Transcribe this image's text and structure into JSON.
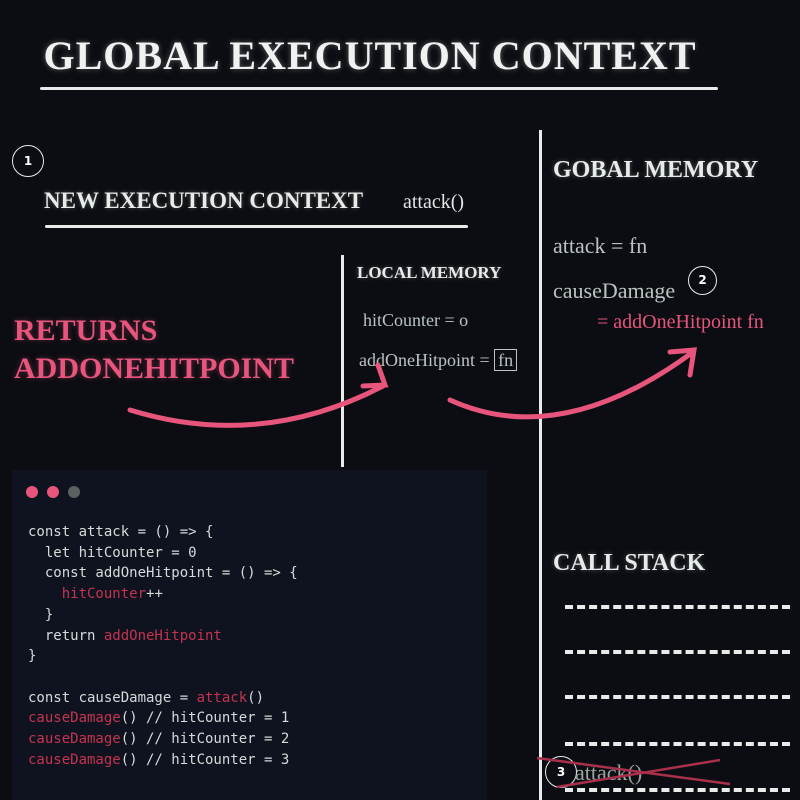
{
  "title": "GLOBAL EXECUTION CONTEXT",
  "step1": {
    "number": "1",
    "heading": "NEW EXECUTION CONTEXT",
    "call": "attack()"
  },
  "local_memory": {
    "heading": "LOCAL MEMORY",
    "hit_counter": "hitCounter = o",
    "add_one_label": "addOneHitpoint =",
    "add_one_value": "fn"
  },
  "returns": {
    "line1": "RETURNS",
    "line2": "ADDONEHITPOINT"
  },
  "global_memory": {
    "heading": "GOBAL MEMORY",
    "attack": "attack = fn",
    "cause_damage": "causeDamage",
    "step2": "2",
    "cause_damage_value": "= addOneHitpoint fn"
  },
  "call_stack": {
    "heading": "CALL STACK",
    "step3": "3",
    "frame": "attack()"
  },
  "code": {
    "lines": [
      [
        [
          "const attack = () => {",
          ""
        ]
      ],
      [
        [
          "  let hitCounter = 0",
          ""
        ]
      ],
      [
        [
          "  const addOneHitpoint = () => {",
          ""
        ]
      ],
      [
        [
          "    ",
          ""
        ],
        [
          "hitCounter",
          "kw"
        ],
        [
          "++",
          ""
        ]
      ],
      [
        [
          "  }",
          ""
        ]
      ],
      [
        [
          "  return ",
          ""
        ],
        [
          "addOneHitpoint",
          "kw"
        ]
      ],
      [
        [
          "}",
          ""
        ]
      ],
      [
        [
          "",
          ""
        ]
      ],
      [
        [
          "const causeDamage = ",
          ""
        ],
        [
          "attack",
          "kw"
        ],
        [
          "()",
          ""
        ]
      ],
      [
        [
          "causeDamage",
          "kw"
        ],
        [
          "() // hitCounter = 1",
          ""
        ]
      ],
      [
        [
          "causeDamage",
          "kw"
        ],
        [
          "() // hitCounter = 2",
          ""
        ]
      ],
      [
        [
          "causeDamage",
          "kw"
        ],
        [
          "() // hitCounter = 3",
          ""
        ]
      ]
    ]
  },
  "colors": {
    "accent": "#e8557c",
    "code_keyword": "#c5334f",
    "background": "#0b0d12",
    "window_dots": [
      "#e8557c",
      "#e8557c",
      "#5a615e"
    ]
  }
}
